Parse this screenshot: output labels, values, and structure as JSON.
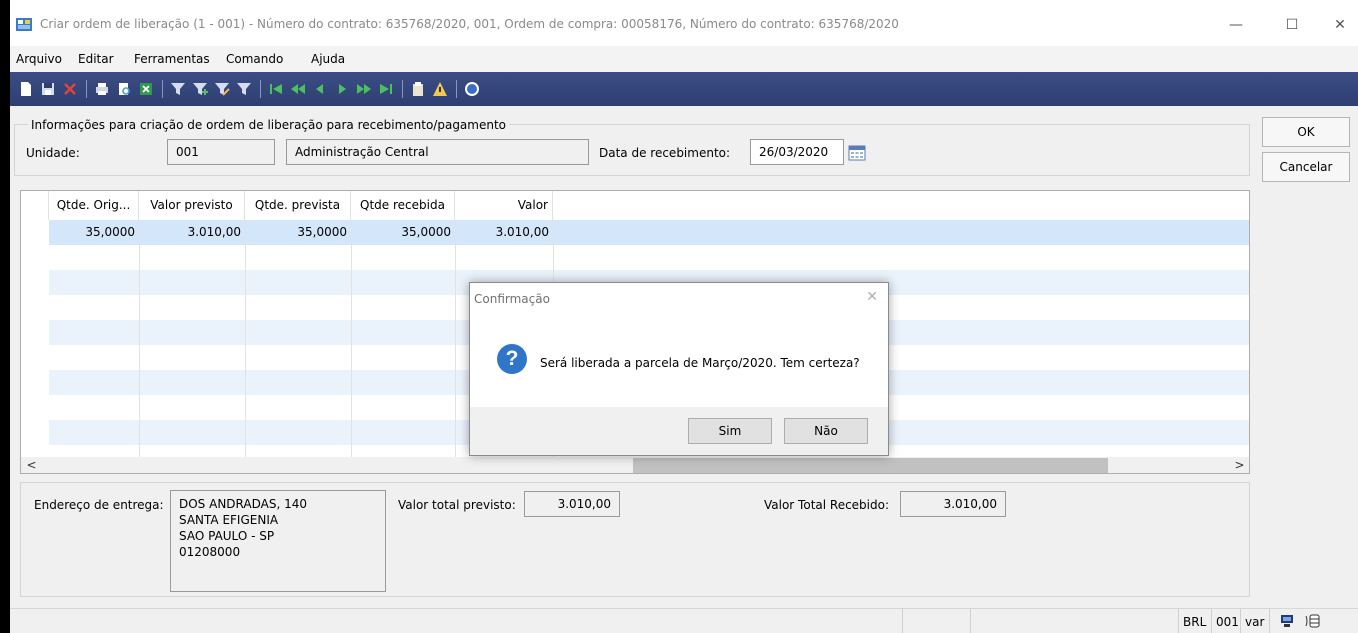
{
  "window": {
    "title": "Criar ordem de liberação (1 - 001) - Número do contrato: 635768/2020, 001, Ordem de compra: 00058176, Número do contrato: 635768/2020",
    "minimize": "—",
    "maximize": "☐",
    "close": "✕"
  },
  "menu": {
    "items": [
      "Arquivo",
      "Editar",
      "Ferramentas",
      "Comando",
      "Ajuda"
    ]
  },
  "colors": {
    "toolbar": "#2e3f72",
    "selected_row": "#d4e6fa",
    "alt_row": "#eaf2fc",
    "dialog_icon": "#2f76c9"
  },
  "form": {
    "group_title": "Informações para criação de ordem de liberação para recebimento/pagamento",
    "unidade_label": "Unidade:",
    "unidade_code": "001",
    "unidade_name": "Administração Central",
    "data_label": "Data de recebimento:",
    "data_value": "26/03/2020"
  },
  "actions": {
    "ok": "OK",
    "cancel": "Cancelar"
  },
  "grid": {
    "columns": [
      "Qtde. Orig...",
      "Valor previsto",
      "Qtde. prevista",
      "Qtde recebida",
      "Valor"
    ],
    "rows": [
      [
        "35,0000",
        "3.010,00",
        "35,0000",
        "35,0000",
        "3.010,00"
      ]
    ],
    "scroll_left": "<",
    "scroll_right": ">"
  },
  "footer": {
    "endereco_label": "Endereço de entrega:",
    "endereco_lines": [
      "DOS ANDRADAS, 140",
      "SANTA EFIGENIA",
      "SAO PAULO - SP",
      "01208000"
    ],
    "valor_previsto_label": "Valor total previsto:",
    "valor_previsto": "3.010,00",
    "valor_recebido_label": "Valor Total Recebido:",
    "valor_recebido": "3.010,00"
  },
  "status": {
    "currency": "BRL",
    "unit": "001",
    "mode": "var"
  },
  "dialog": {
    "title": "Confirmação",
    "close": "✕",
    "icon": "?",
    "message": "Será liberada a parcela de Março/2020. Tem certeza?",
    "yes": "Sim",
    "no": "Não"
  }
}
